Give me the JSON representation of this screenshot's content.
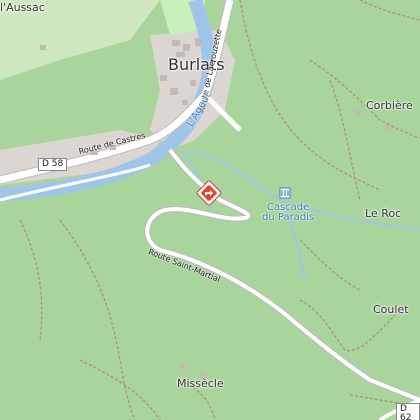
{
  "map": {
    "places": {
      "town": "Burlats",
      "aussac": "l'Aussac",
      "corbiere": "Corbière",
      "le_roc": "Le Roc",
      "coulet": "Coulet",
      "missecle": "Missècle"
    },
    "roads": {
      "castres": "Route de Castres",
      "lacrouzette": "Route de Lacrouzette",
      "saint_martial": "Route Saint-Martial"
    },
    "shields": {
      "d58": "D 58",
      "d62": "D 62"
    },
    "water": {
      "river": "L'Agout",
      "waterfall": "Cascade\ndu Paradis"
    },
    "marker": {
      "icon": "directions-icon",
      "color": "#e8452e"
    },
    "colors": {
      "forest": "#a9d49c",
      "urban": "#dcd6d2",
      "river": "#9fc6e8",
      "road": "#ffffff",
      "track": "#b38b6d"
    }
  }
}
